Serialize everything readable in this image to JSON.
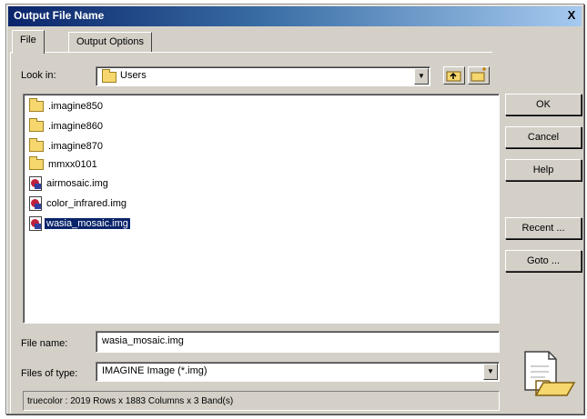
{
  "window": {
    "title": "Output File Name",
    "close_glyph": "X"
  },
  "tabs": [
    {
      "label": "File",
      "active": true
    },
    {
      "label": "Output Options",
      "active": false
    }
  ],
  "look_in": {
    "label": "Look in:",
    "value": "Users",
    "icon": "folder-icon"
  },
  "files": [
    {
      "name": ".imagine850",
      "type": "folder"
    },
    {
      "name": ".imagine860",
      "type": "folder"
    },
    {
      "name": ".imagine870",
      "type": "folder"
    },
    {
      "name": "mmxx0101",
      "type": "folder"
    },
    {
      "name": "airmosaic.img",
      "type": "image"
    },
    {
      "name": "color_infrared.img",
      "type": "image"
    },
    {
      "name": "wasia_mosaic.img",
      "type": "image",
      "selected": true
    }
  ],
  "file_name": {
    "label": "File name:",
    "value": "wasia_mosaic.img"
  },
  "file_type": {
    "label": "Files of type:",
    "value": "IMAGINE Image (*.img)"
  },
  "status": "truecolor : 2019 Rows x 1883 Columns x 3 Band(s)",
  "buttons": {
    "ok": "OK",
    "cancel": "Cancel",
    "help": "Help",
    "recent": "Recent ...",
    "goto": "Goto ..."
  },
  "colors": {
    "selection": "#0a246a",
    "dialog_bg": "#d4d0c8"
  }
}
